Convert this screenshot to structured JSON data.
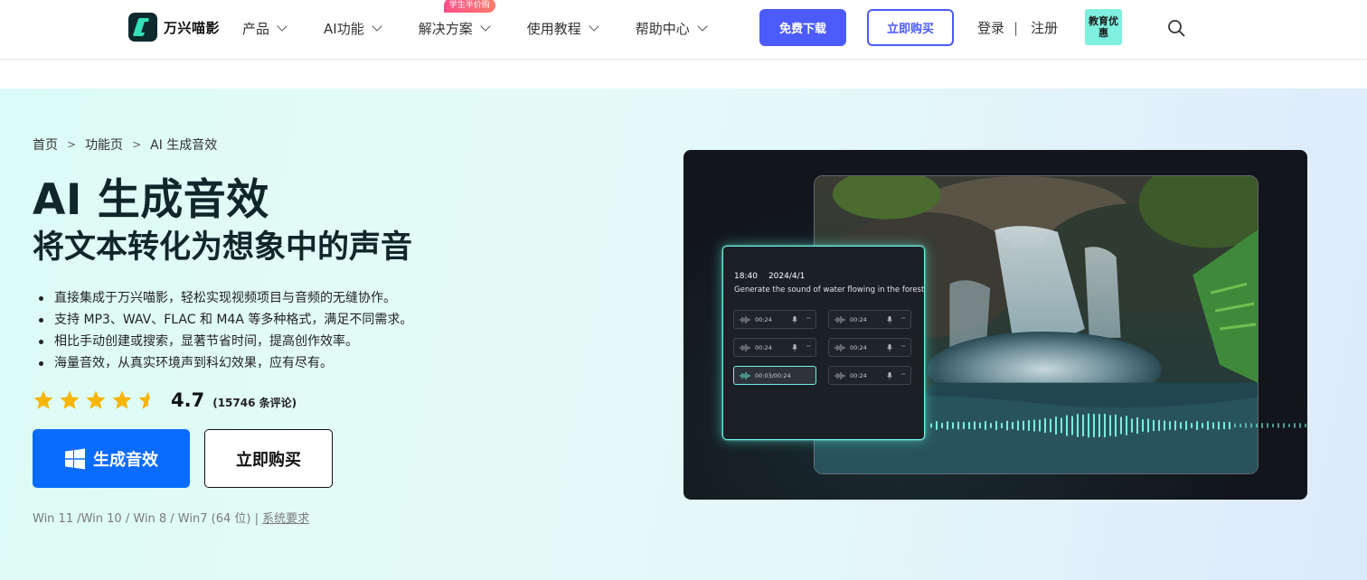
{
  "nav": {
    "brand": "万兴喵影",
    "items": [
      {
        "label": "产品"
      },
      {
        "label": "AI功能"
      },
      {
        "label": "解决方案",
        "badge": "学生半价购"
      },
      {
        "label": "使用教程"
      },
      {
        "label": "帮助中心"
      }
    ],
    "download_label": "免费下载",
    "buy_label": "立即购买",
    "login_label": "登录",
    "separator": "|",
    "register_label": "注册",
    "edu_label": "教育优惠"
  },
  "breadcrumb": {
    "items": [
      "首页",
      "功能页",
      "AI 生成音效"
    ],
    "separator": ">"
  },
  "hero": {
    "title": "AI 生成音效",
    "subtitle": "将文本转化为想象中的声音",
    "bullets": [
      "直接集成于万兴喵影，轻松实现视频项目与音频的无缝协作。",
      "支持 MP3、WAV、FLAC 和 M4A 等多种格式，满足不同需求。",
      "相比手动创建或搜索，显著节省时间，提高创作效率。",
      "海量音效，从真实环境声到科幻效果，应有尽有。"
    ],
    "rating": {
      "stars": 4.5,
      "score": "4.7",
      "reviews": "(15746 条评论)"
    },
    "primary_button": "生成音效",
    "secondary_button": "立即购买",
    "sysreq_text": "Win 11 /Win 10 / Win 8 / Win7 (64 位) | ",
    "sysreq_link": "系统要求"
  },
  "media": {
    "time": "18:40",
    "date": "2024/4/1",
    "prompt": "Generate the sound of water flowing in the forest",
    "clips": [
      "00:24",
      "00:24",
      "00:24",
      "00:24",
      "00:03/00:24",
      "00:24"
    ],
    "active_clip": 4,
    "colors": {
      "accent": "#6ef2e0",
      "panel": "#12161c"
    }
  },
  "colors": {
    "brand_blue": "#4c5bfb",
    "primary_blue": "#0a6cff",
    "star": "#f7b500",
    "title": "#10262a"
  }
}
